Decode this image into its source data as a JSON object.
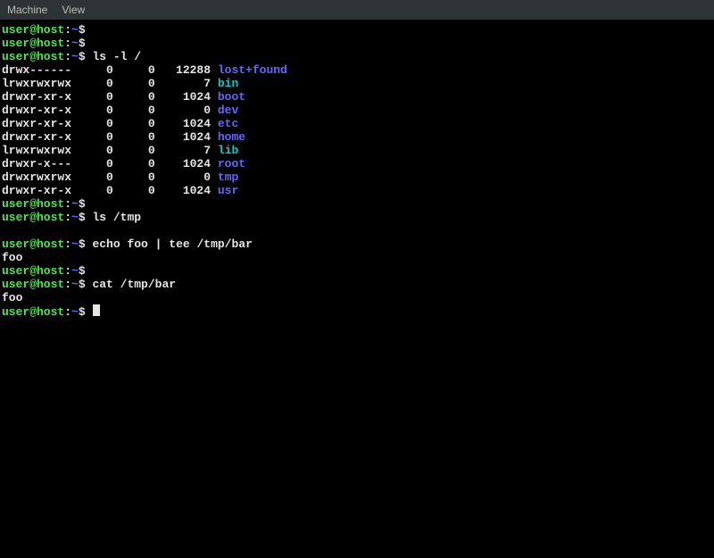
{
  "menubar": {
    "machine": "Machine",
    "view": "View"
  },
  "prompt": {
    "user_host": "user@host",
    "path": "~",
    "symbol": "$"
  },
  "lines": [
    {
      "type": "prompt",
      "cmd": ""
    },
    {
      "type": "prompt",
      "cmd": ""
    },
    {
      "type": "prompt",
      "cmd": "ls -l /"
    },
    {
      "type": "ls",
      "perm": "drwx------",
      "n1": "0",
      "n2": "0",
      "sz": "12288",
      "name": "lost+found",
      "cls": "blu"
    },
    {
      "type": "ls",
      "perm": "lrwxrwxrwx",
      "n1": "0",
      "n2": "0",
      "sz": "7",
      "name": "bin",
      "cls": "cyn"
    },
    {
      "type": "ls",
      "perm": "drwxr-xr-x",
      "n1": "0",
      "n2": "0",
      "sz": "1024",
      "name": "boot",
      "cls": "blu"
    },
    {
      "type": "ls",
      "perm": "drwxr-xr-x",
      "n1": "0",
      "n2": "0",
      "sz": "0",
      "name": "dev",
      "cls": "blu"
    },
    {
      "type": "ls",
      "perm": "drwxr-xr-x",
      "n1": "0",
      "n2": "0",
      "sz": "1024",
      "name": "etc",
      "cls": "blu"
    },
    {
      "type": "ls",
      "perm": "drwxr-xr-x",
      "n1": "0",
      "n2": "0",
      "sz": "1024",
      "name": "home",
      "cls": "blu"
    },
    {
      "type": "ls",
      "perm": "lrwxrwxrwx",
      "n1": "0",
      "n2": "0",
      "sz": "7",
      "name": "lib",
      "cls": "cyn"
    },
    {
      "type": "ls",
      "perm": "drwxr-x---",
      "n1": "0",
      "n2": "0",
      "sz": "1024",
      "name": "root",
      "cls": "blu"
    },
    {
      "type": "ls",
      "perm": "drwxrwxrwx",
      "n1": "0",
      "n2": "0",
      "sz": "0",
      "name": "tmp",
      "cls": "blu"
    },
    {
      "type": "ls",
      "perm": "drwxr-xr-x",
      "n1": "0",
      "n2": "0",
      "sz": "1024",
      "name": "usr",
      "cls": "blu"
    },
    {
      "type": "prompt",
      "cmd": ""
    },
    {
      "type": "prompt",
      "cmd": "ls /tmp"
    },
    {
      "type": "blank"
    },
    {
      "type": "prompt",
      "cmd": "echo foo | tee /tmp/bar"
    },
    {
      "type": "out",
      "text": "foo"
    },
    {
      "type": "prompt",
      "cmd": ""
    },
    {
      "type": "prompt",
      "cmd": "cat /tmp/bar"
    },
    {
      "type": "out",
      "text": "foo"
    },
    {
      "type": "prompt",
      "cmd": "",
      "cursor": true
    }
  ]
}
